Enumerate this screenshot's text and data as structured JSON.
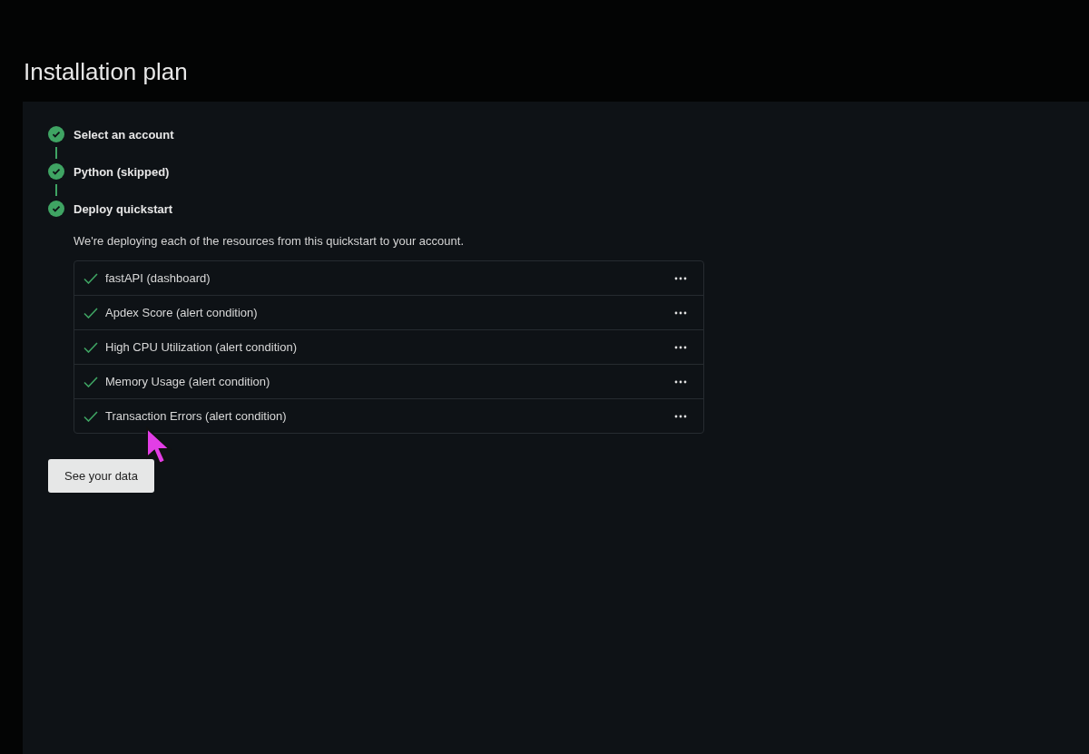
{
  "title": "Installation plan",
  "steps": [
    {
      "label": "Select an account",
      "done": true
    },
    {
      "label": "Python (skipped)",
      "done": true
    },
    {
      "label": "Deploy quickstart",
      "done": true
    }
  ],
  "description": "We're deploying each of the resources from this quickstart to your account.",
  "resources": [
    {
      "label": "fastAPI (dashboard)",
      "done": true
    },
    {
      "label": "Apdex Score (alert condition)",
      "done": true
    },
    {
      "label": "High CPU Utilization (alert condition)",
      "done": true
    },
    {
      "label": "Memory Usage (alert condition)",
      "done": true
    },
    {
      "label": "Transaction Errors (alert condition)",
      "done": true
    }
  ],
  "button": "See your data"
}
